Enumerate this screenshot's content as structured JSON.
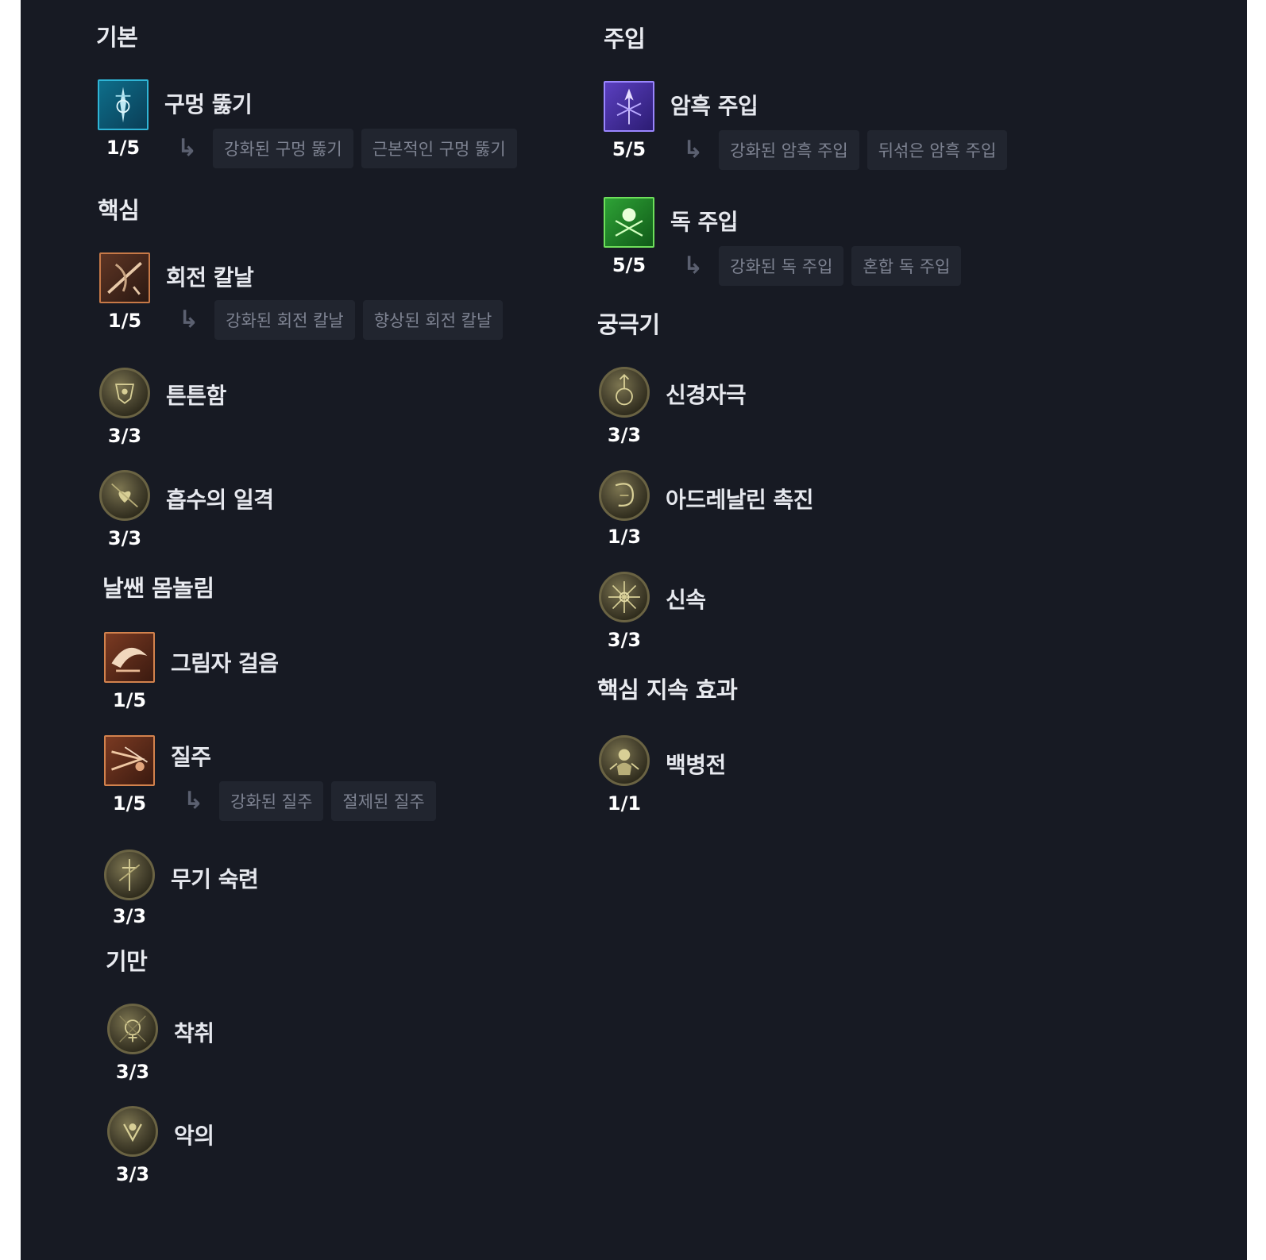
{
  "colors": {
    "background": "#171a23",
    "chip_bg": "#21252f",
    "chip_text": "#7e8392",
    "text": "#e6e8ee"
  },
  "left": {
    "basic": {
      "title": "기본",
      "skill": {
        "name": "구멍 뚫기",
        "rank": "1/5",
        "icon": "puncture-icon",
        "mods": [
          "강화된 구멍 뚫기",
          "근본적인 구멍 뚫기"
        ]
      }
    },
    "core": {
      "title": "핵심",
      "skills": [
        {
          "name": "회전 칼날",
          "rank": "1/5",
          "icon": "twisting-blades-icon",
          "mods": [
            "강화된 회전 칼날",
            "향상된 회전 칼날"
          ]
        },
        {
          "name": "튼튼함",
          "rank": "3/3",
          "icon": "sturdy-icon"
        },
        {
          "name": "흡수의 일격",
          "rank": "3/3",
          "icon": "siphoning-strikes-icon"
        }
      ]
    },
    "agility": {
      "title": "날쌘 몸놀림",
      "skills": [
        {
          "name": "그림자 걸음",
          "rank": "1/5",
          "icon": "shadow-step-icon"
        },
        {
          "name": "질주",
          "rank": "1/5",
          "icon": "dash-icon",
          "mods": [
            "강화된 질주",
            "절제된 질주"
          ]
        },
        {
          "name": "무기 숙련",
          "rank": "3/3",
          "icon": "weapon-mastery-icon"
        }
      ]
    },
    "subterfuge": {
      "title": "기만",
      "skills": [
        {
          "name": "착취",
          "rank": "3/3",
          "icon": "exploit-icon"
        },
        {
          "name": "악의",
          "rank": "3/3",
          "icon": "malice-icon"
        }
      ]
    }
  },
  "right": {
    "imbuement": {
      "title": "주입",
      "skills": [
        {
          "name": "암흑 주입",
          "rank": "5/5",
          "icon": "shadow-imbuement-icon",
          "mods": [
            "강화된 암흑 주입",
            "뒤섞은 암흑 주입"
          ]
        },
        {
          "name": "독 주입",
          "rank": "5/5",
          "icon": "poison-imbuement-icon",
          "mods": [
            "강화된 독 주입",
            "혼합 독 주입"
          ]
        }
      ]
    },
    "ultimate": {
      "title": "궁극기",
      "skills": [
        {
          "name": "신경자극",
          "rank": "3/3",
          "icon": "innervation-icon"
        },
        {
          "name": "아드레날린 촉진",
          "rank": "1/3",
          "icon": "adrenaline-rush-icon"
        },
        {
          "name": "신속",
          "rank": "3/3",
          "icon": "haste-icon"
        }
      ]
    },
    "keystone": {
      "title": "핵심 지속 효과",
      "skills": [
        {
          "name": "백병전",
          "rank": "1/1",
          "icon": "close-quarters-combat-icon"
        }
      ]
    }
  }
}
